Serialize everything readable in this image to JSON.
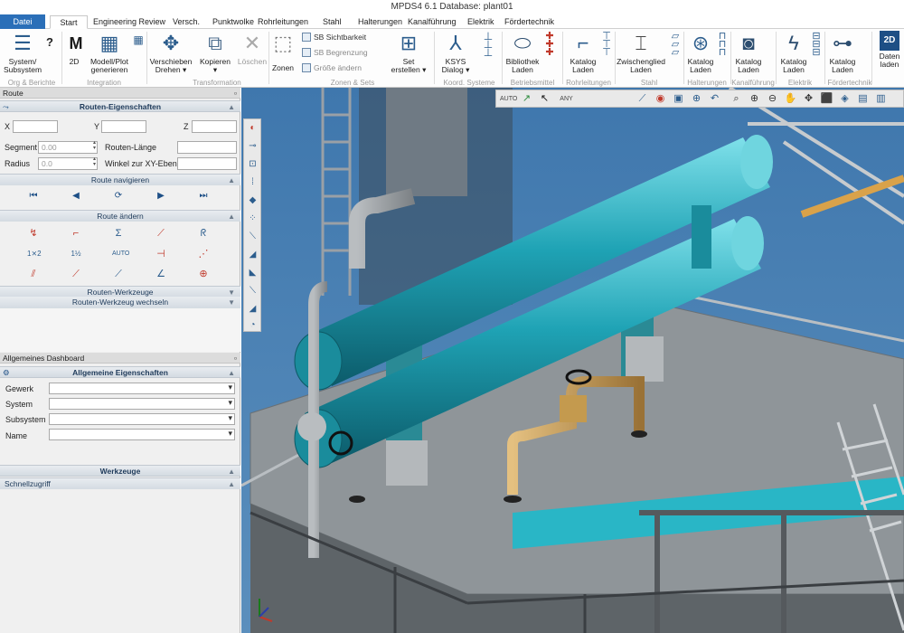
{
  "window": {
    "title": "MPDS4 6.1   Database: plant01"
  },
  "menu_tabs": [
    "Datei",
    "Start",
    "Engineering Review",
    "Versch.",
    "Punktwolke",
    "Rohrleitungen",
    "Stahl",
    "Halterungen",
    "Kanalführung",
    "Elektrik",
    "Fördertechnik"
  ],
  "ribbon": {
    "system_subsystem": "System/\nSubsystem",
    "help": "?",
    "m2d": "2D",
    "modell_plot": "Modell/Plot\ngenerieren",
    "verschieben": "Verschieben\nDrehen ▾",
    "kopieren": "Kopieren\n▾",
    "loeschen": "Löschen",
    "zonen": "Zonen",
    "sb_sichtbarkeit": "SB Sichtbarkeit",
    "sb_begrenzung": "SB Begrenzung",
    "groesse_aendern": "Größe ändern",
    "set_erstellen": "Set\nerstellen ▾",
    "ksys_dialog": "KSYS\nDialog ▾",
    "bibliothek_laden": "Bibliothek\nLaden",
    "katalog_laden": "Katalog\nLaden",
    "zwischenglied_laden": "Zwischenglied\nLaden",
    "daten_laden": "Daten\nladen",
    "groups": {
      "org": "Org & Berichte",
      "integration": "Integration",
      "transformation": "Transformation",
      "zonen_sets": "Zonen & Sets",
      "koord": "Koord. Systeme",
      "betriebsmittel": "Betriebsmittel",
      "rohrleitungen": "Rohrleitungen",
      "stahl": "Stahl",
      "halterungen": "Halterungen",
      "kanalfuehrung": "Kanalführung",
      "elektrik": "Elektrik",
      "foerdertechnik": "Fördertechnik"
    }
  },
  "route_panel": {
    "title": "Route",
    "properties_header": "Routen-Eigenschaften",
    "x": "X",
    "y": "Y",
    "z": "Z",
    "segment": "Segment",
    "segment_value": "0.00",
    "radius": "Radius",
    "radius_value": "0.0",
    "routen_laenge": "Routen-Länge",
    "winkel": "Winkel zur XY-Ebene",
    "navigate_header": "Route navigieren",
    "change_header": "Route ändern",
    "tools_header": "Routen-Werkzeuge",
    "tool_switch": "Routen-Werkzeug wechseln"
  },
  "dashboard": {
    "title": "Allgemeines Dashboard",
    "properties_header": "Allgemeine Eigenschaften",
    "fields": [
      "Gewerk",
      "System",
      "Subsystem",
      "Name"
    ],
    "tools_header": "Werkzeuge",
    "quick_access": "Schnellzugriff"
  },
  "colors": {
    "file_tab": "#2b6fb8",
    "pipe_teal": "#1f9fb3",
    "pipe_brass": "#c49a4e",
    "steel_gray": "#8f9599",
    "background_blue": "#4b7fb0"
  }
}
